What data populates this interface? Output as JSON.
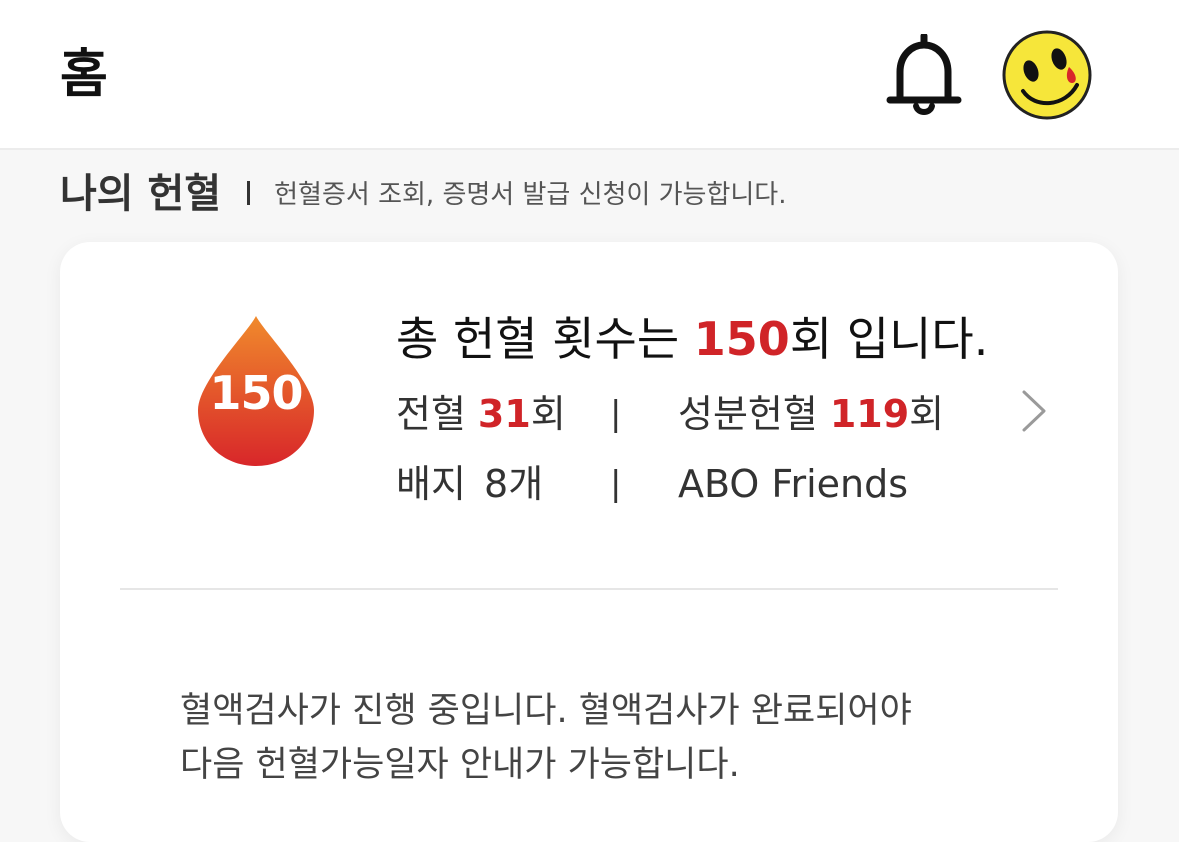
{
  "header": {
    "title": "홈",
    "bell_icon": "bell-icon",
    "avatar_icon": "smiley-avatar"
  },
  "section": {
    "title": "나의 헌혈",
    "subtitle": "헌혈증서 조회, 증명서 발급 신청이 가능합니다."
  },
  "card": {
    "badge_count": "150",
    "summary_prefix": "총 헌혈 횟수는 ",
    "summary_count": "150",
    "summary_suffix": "회 입니다.",
    "whole_blood_label": "전혈",
    "whole_blood_count": "31",
    "times_unit": "회",
    "component_label": "성분헌혈",
    "component_count": "119",
    "badge_label": "배지",
    "badge_value": "8개",
    "separator": "|",
    "friends_label": "ABO Friends",
    "chevron_icon": "chevron-right-icon"
  },
  "notice": {
    "line1": "혈액검사가 진행 중입니다. 혈액검사가 완료되어야",
    "line2": "다음 헌혈가능일자 안내가 가능합니다."
  },
  "colors": {
    "accent": "#d02428",
    "drop_top": "#f08a2c",
    "drop_bottom": "#d8262a"
  }
}
